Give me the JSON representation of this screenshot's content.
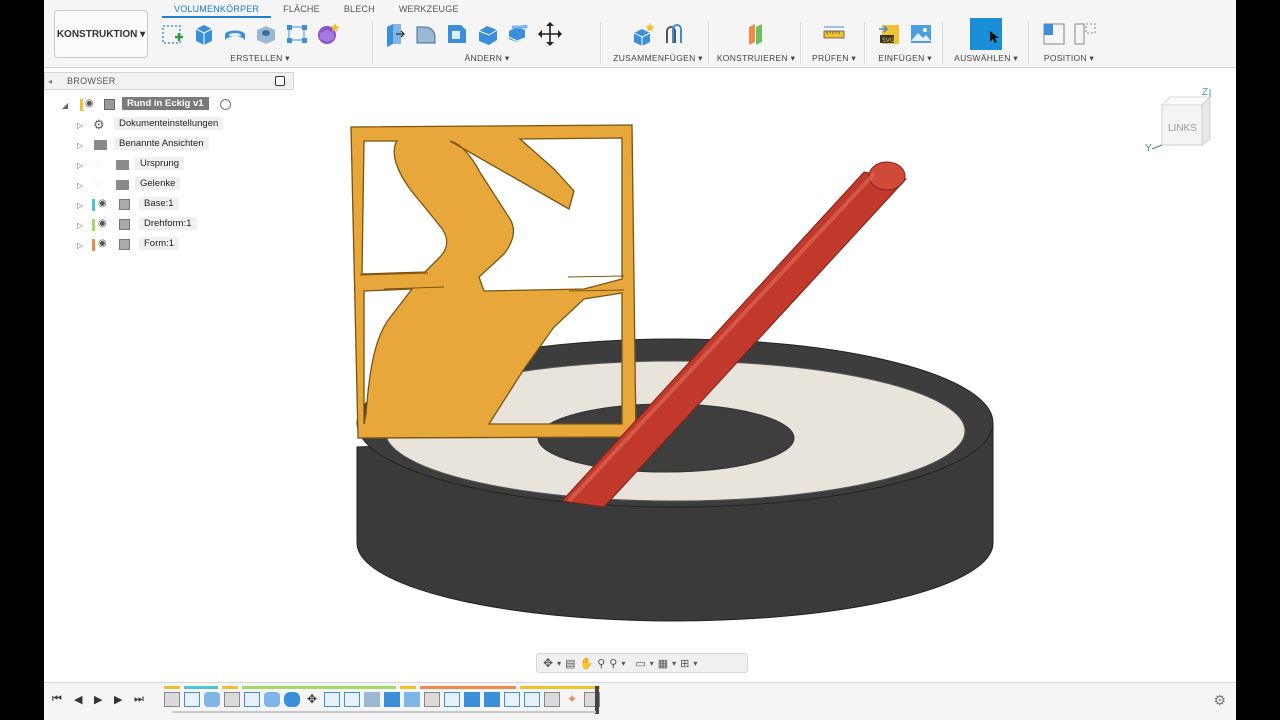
{
  "workspace": {
    "label": "KONSTRUKTION ▾"
  },
  "tabs": [
    "VOLUMENKÖRPER",
    "FLÄCHE",
    "BLECH",
    "WERKZEUGE"
  ],
  "groups": {
    "erstellen": "ERSTELLEN ▾",
    "aendern": "ÄNDERN ▾",
    "zusammenfuegen": "ZUSAMMENFÜGEN ▾",
    "konstruieren": "KONSTRUIEREN ▾",
    "pruefen": "PRÜFEN ▾",
    "einfuegen": "EINFÜGEN ▾",
    "auswaehlen": "AUSWÄHLEN ▾",
    "position": "POSITION ▾"
  },
  "browser": {
    "title": "BROWSER",
    "root": "Rund in Eckig v1",
    "items": [
      {
        "label": "Dokumenteinstellungen",
        "kind": "gear"
      },
      {
        "label": "Benannte Ansichten",
        "kind": "folder"
      },
      {
        "label": "Ursprung",
        "kind": "folder-hidden"
      },
      {
        "label": "Gelenke",
        "kind": "folder-hidden"
      },
      {
        "label": "Base:1",
        "kind": "component",
        "color": "#4fc3d9"
      },
      {
        "label": "Drehform:1",
        "kind": "component",
        "color": "#a6d96a"
      },
      {
        "label": "Form:1",
        "kind": "component",
        "color": "#f08a4b"
      }
    ]
  },
  "viewcube": {
    "face": "LINKS",
    "axis_z": "Z",
    "axis_y": "Y"
  },
  "colors": {
    "accent": "#1a7fd0",
    "frame_orange": "#e8a73a",
    "rod_red": "#c0392b",
    "base_dark": "#3a3a3a",
    "base_top": "#e8e4dc"
  }
}
